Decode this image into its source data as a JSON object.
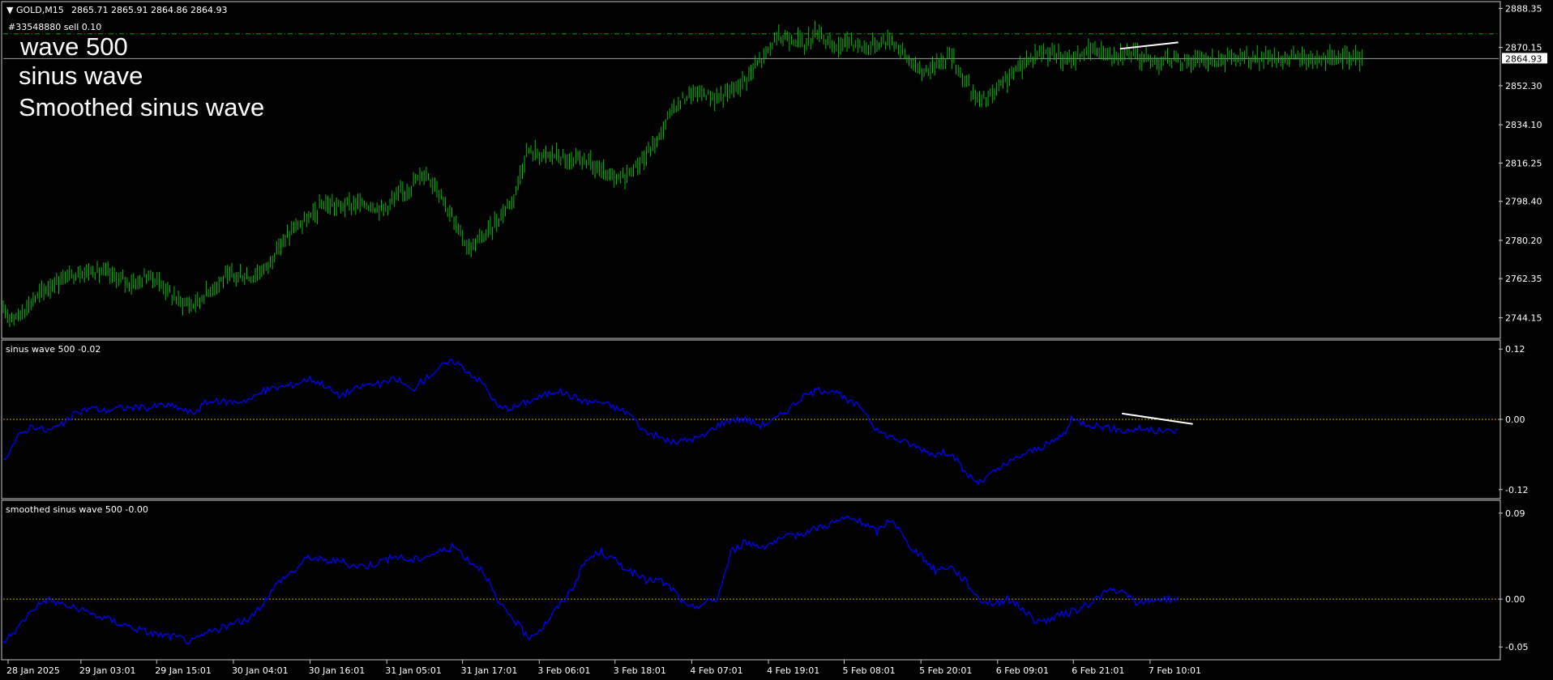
{
  "header": {
    "symbol": "GOLD,M15",
    "ohlc": "2865.71 2865.91 2864.86 2864.93",
    "order": "#33548880 sell 0.10"
  },
  "overlay_text": [
    "wave 500",
    "sinus wave",
    "Smoothed sinus wave"
  ],
  "colors": {
    "background": "#000000",
    "price_candles": "#00c000",
    "indicator_line": "#0000ff",
    "zero_line": "#c8a000",
    "level_line": "#00a000",
    "trend_line": "#ffffff",
    "frame": "#c8c8c8"
  },
  "chart_data": [
    {
      "name": "price",
      "type": "line",
      "series": [
        {
          "x": [
            0,
            15,
            30,
            45,
            60,
            75,
            90,
            105,
            120,
            135,
            150,
            165,
            180,
            195,
            210,
            225,
            240,
            255,
            270,
            285,
            300,
            315,
            330,
            345,
            360,
            375,
            390,
            405,
            420,
            435,
            450,
            465,
            480,
            495,
            510,
            525,
            540,
            555,
            570,
            585,
            600,
            615,
            630,
            645,
            660,
            675,
            690,
            705,
            720,
            735,
            750,
            765,
            780,
            795,
            810,
            825,
            840,
            855,
            870,
            885,
            900,
            915,
            930,
            945,
            960,
            975,
            990,
            1005,
            1020,
            1035,
            1050,
            1065,
            1080,
            1095,
            1110,
            1125,
            1140,
            1155,
            1170,
            1185,
            1200,
            1215,
            1230,
            1245,
            1260,
            1275,
            1290,
            1305,
            1320,
            1335,
            1350,
            1365,
            1380,
            1395,
            1400
          ],
          "values": [
            2746,
            2745,
            2752,
            2758,
            2762,
            2765,
            2766,
            2765,
            2762,
            2760,
            2764,
            2759,
            2752,
            2750,
            2756,
            2762,
            2764,
            2763,
            2767,
            2778,
            2786,
            2790,
            2797,
            2796,
            2797,
            2797,
            2795,
            2800,
            2806,
            2812,
            2803,
            2788,
            2776,
            2782,
            2790,
            2800,
            2822,
            2820,
            2820,
            2816,
            2818,
            2812,
            2808,
            2812,
            2818,
            2828,
            2842,
            2848,
            2849,
            2846,
            2850,
            2856,
            2864,
            2874,
            2875,
            2872,
            2878,
            2869,
            2874,
            2870,
            2872,
            2874,
            2866,
            2858,
            2862,
            2867,
            2855,
            2845,
            2848,
            2856,
            2862,
            2868,
            2868,
            2863,
            2867,
            2869,
            2867,
            2868,
            2866,
            2864,
            2864,
            2864,
            2864,
            2864,
            2865,
            2865,
            2865,
            2865,
            2865,
            2865,
            2865,
            2865,
            2865,
            2865,
            2864.93
          ],
          "kind": "candles",
          "bar_width": 1.1
        }
      ],
      "ylim": [
        2736,
        2890
      ],
      "yticks": [
        2888.35,
        2870.15,
        2852.3,
        2834.1,
        2816.25,
        2798.4,
        2780.2,
        2762.35,
        2744.15
      ],
      "ytick_labels": [
        "2888.35",
        "2870.15",
        "2852.30",
        "2834.10",
        "2816.25",
        "2798.40",
        "2780.20",
        "2762.35",
        "2744.15"
      ],
      "price_label": "2864.93",
      "level_value": 2876.5,
      "trend_line": {
        "x1": 1150,
        "y1": 2869.5,
        "x2": 1210,
        "y2": 2872.5
      }
    },
    {
      "name": "sinus",
      "type": "line",
      "label": "sinus wave 500 -0.02",
      "series": [
        {
          "x": [
            0,
            15,
            30,
            45,
            60,
            75,
            90,
            105,
            120,
            135,
            150,
            165,
            180,
            195,
            210,
            225,
            240,
            255,
            270,
            285,
            300,
            315,
            330,
            345,
            360,
            375,
            390,
            405,
            420,
            435,
            450,
            465,
            480,
            495,
            510,
            525,
            540,
            555,
            570,
            585,
            600,
            615,
            630,
            645,
            660,
            675,
            690,
            705,
            720,
            735,
            750,
            765,
            780,
            795,
            810,
            825,
            840,
            855,
            870,
            885,
            900,
            915,
            930,
            945,
            960,
            975,
            990,
            1005,
            1020,
            1035,
            1050,
            1065,
            1080,
            1095,
            1100,
            1110,
            1125,
            1140,
            1155,
            1170,
            1185,
            1200,
            1210
          ],
          "values": [
            -0.07,
            -0.03,
            -0.01,
            -0.02,
            -0.01,
            0.01,
            0.02,
            0.015,
            0.02,
            0.02,
            0.02,
            0.025,
            0.02,
            0.01,
            0.03,
            0.03,
            0.03,
            0.035,
            0.05,
            0.055,
            0.06,
            0.07,
            0.06,
            0.04,
            0.05,
            0.06,
            0.06,
            0.07,
            0.05,
            0.07,
            0.09,
            0.1,
            0.08,
            0.06,
            0.02,
            0.02,
            0.03,
            0.04,
            0.05,
            0.04,
            0.03,
            0.03,
            0.02,
            0.01,
            -0.02,
            -0.03,
            -0.04,
            -0.035,
            -0.03,
            -0.01,
            0.0,
            0.0,
            -0.01,
            0.0,
            0.02,
            0.04,
            0.05,
            0.05,
            0.03,
            0.02,
            -0.02,
            -0.03,
            -0.04,
            -0.05,
            -0.06,
            -0.055,
            -0.09,
            -0.11,
            -0.09,
            -0.075,
            -0.06,
            -0.05,
            -0.04,
            -0.02,
            0.0,
            -0.005,
            -0.01,
            -0.015,
            -0.02,
            -0.015,
            -0.02,
            -0.02,
            -0.02
          ],
          "color": "#0000ff"
        }
      ],
      "ylim": [
        -0.13,
        0.13
      ],
      "yticks": [
        0.12,
        0.0,
        -0.12
      ],
      "ytick_labels": [
        "0.12",
        "0.00",
        "-0.12"
      ],
      "zero_value": 0,
      "trend_line": {
        "x1": 1152,
        "y1": 0.01,
        "x2": 1225,
        "y2": -0.008
      }
    },
    {
      "name": "smoothed",
      "type": "line",
      "label": "smoothed sinus wave 500 -0.00",
      "series": [
        {
          "x": [
            0,
            15,
            30,
            45,
            60,
            75,
            90,
            105,
            120,
            135,
            150,
            165,
            180,
            195,
            210,
            225,
            240,
            255,
            270,
            285,
            300,
            315,
            330,
            345,
            360,
            375,
            390,
            405,
            420,
            435,
            450,
            465,
            480,
            495,
            510,
            525,
            540,
            555,
            570,
            585,
            600,
            615,
            630,
            645,
            660,
            675,
            690,
            705,
            720,
            735,
            750,
            765,
            780,
            795,
            810,
            825,
            840,
            855,
            870,
            885,
            900,
            915,
            930,
            945,
            960,
            975,
            990,
            1005,
            1020,
            1035,
            1050,
            1065,
            1080,
            1095,
            1110,
            1125,
            1140,
            1155,
            1170,
            1185,
            1200,
            1210
          ],
          "values": [
            -0.045,
            -0.03,
            -0.01,
            0.0,
            -0.005,
            -0.01,
            -0.015,
            -0.02,
            -0.025,
            -0.03,
            -0.035,
            -0.038,
            -0.04,
            -0.045,
            -0.035,
            -0.03,
            -0.025,
            -0.02,
            0.0,
            0.02,
            0.03,
            0.045,
            0.04,
            0.04,
            0.035,
            0.035,
            0.04,
            0.045,
            0.04,
            0.045,
            0.05,
            0.055,
            0.04,
            0.03,
            -0.005,
            -0.02,
            -0.04,
            -0.03,
            -0.01,
            0.01,
            0.04,
            0.05,
            0.04,
            0.03,
            0.02,
            0.02,
            0.01,
            -0.01,
            -0.005,
            0.0,
            0.05,
            0.06,
            0.055,
            0.06,
            0.065,
            0.07,
            0.075,
            0.08,
            0.085,
            0.08,
            0.07,
            0.085,
            0.06,
            0.045,
            0.03,
            0.035,
            0.02,
            0.0,
            -0.005,
            0.0,
            -0.01,
            -0.025,
            -0.02,
            -0.015,
            -0.01,
            0.0,
            0.01,
            0.005,
            -0.005,
            0.0,
            0.0,
            0.0
          ],
          "color": "#0000ff"
        }
      ],
      "ylim": [
        -0.06,
        0.1
      ],
      "yticks": [
        0.09,
        0.0,
        -0.05
      ],
      "ytick_labels": [
        "0.09",
        "0.00",
        "-0.05"
      ],
      "zero_value": 0
    }
  ],
  "xaxis": {
    "range": [
      0,
      1540
    ],
    "ticks": [
      {
        "x": 5,
        "label": "28 Jan 2025"
      },
      {
        "x": 80,
        "label": "29 Jan 03:01"
      },
      {
        "x": 158,
        "label": "29 Jan 15:01"
      },
      {
        "x": 237,
        "label": "30 Jan 04:01"
      },
      {
        "x": 316,
        "label": "30 Jan 16:01"
      },
      {
        "x": 395,
        "label": "31 Jan 05:01"
      },
      {
        "x": 473,
        "label": "31 Jan 17:01"
      },
      {
        "x": 552,
        "label": "3 Feb 06:01"
      },
      {
        "x": 630,
        "label": "3 Feb 18:01"
      },
      {
        "x": 709,
        "label": "4 Feb 07:01"
      },
      {
        "x": 788,
        "label": "4 Feb 19:01"
      },
      {
        "x": 866,
        "label": "5 Feb 08:01"
      },
      {
        "x": 945,
        "label": "5 Feb 20:01"
      },
      {
        "x": 1024,
        "label": "6 Feb 09:01"
      },
      {
        "x": 1102,
        "label": "6 Feb 21:01"
      },
      {
        "x": 1181,
        "label": "7 Feb 10:01"
      }
    ]
  }
}
